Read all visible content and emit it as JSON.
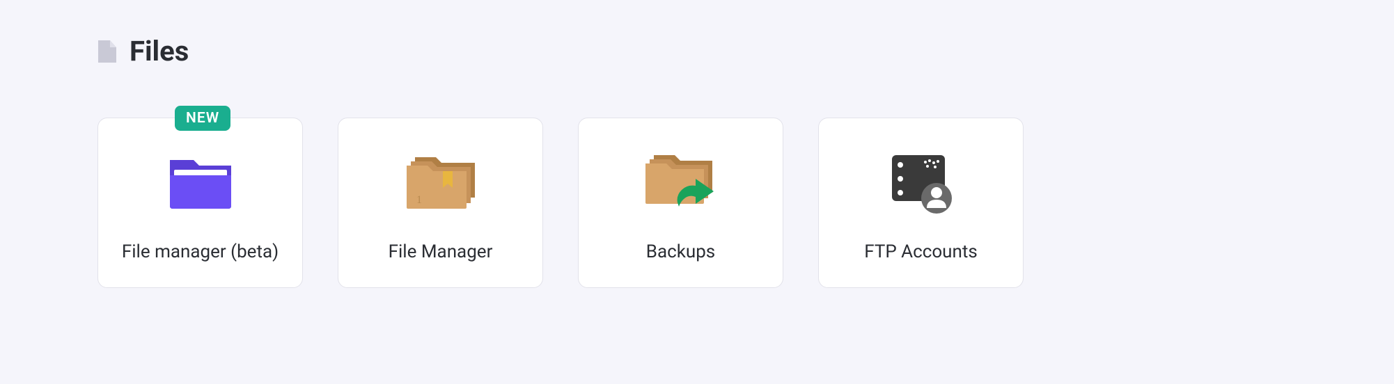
{
  "section": {
    "title": "Files",
    "header_icon": "file-icon"
  },
  "cards": [
    {
      "label": "File manager (beta)",
      "badge": "NEW",
      "icon": "folder-purple-icon"
    },
    {
      "label": "File Manager",
      "badge": null,
      "icon": "folder-brown-icon"
    },
    {
      "label": "Backups",
      "badge": null,
      "icon": "folder-arrow-icon"
    },
    {
      "label": "FTP Accounts",
      "badge": null,
      "icon": "server-user-icon"
    }
  ],
  "colors": {
    "badge_bg": "#1aae8f",
    "card_bg": "#ffffff",
    "page_bg": "#f5f5fb"
  }
}
